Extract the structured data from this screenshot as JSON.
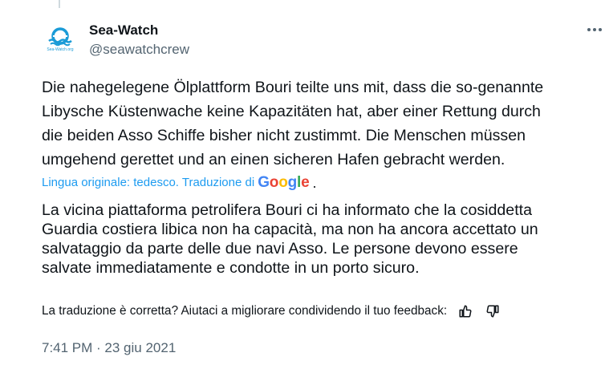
{
  "author": {
    "display_name": "Sea-Watch",
    "handle": "@seawatchcrew",
    "avatar_caption": "Sea-Watch.org"
  },
  "tweet": {
    "original_text": "Die nahegelegene Ölplattform Bouri teilte uns mit, dass die so-genannte\nLibysche Küstenwache keine Kapazitäten hat, aber einer Rettung durch\ndie beiden Asso Schiffe bisher nicht zustimmt. Die Menschen müssen\numgehend gerettet und an einen sicheren Hafen gebracht werden.",
    "translation_note": "Lingua originale: tedesco. Traduzione di",
    "translation_provider": "Google",
    "translated_text": "La vicina piattaforma petrolifera Bouri ci ha informato che la cosiddetta\nGuardia costiera libica non ha capacità, ma non ha ancora accettato un\nsalvataggio da parte delle due navi Asso. Le persone devono essere\nsalvate immediatamente e condotte in un porto sicuro.",
    "feedback_prompt": "La traduzione è corretta? Aiutaci a migliorare condividendo il tuo feedback:",
    "timestamp": "7:41 PM · 23 giu 2021"
  },
  "icons": {
    "more": "more-horizontal-icon",
    "thumbs_up": "thumbs-up-icon",
    "thumbs_down": "thumbs-down-icon"
  },
  "colors": {
    "link_blue": "#1d9bf0",
    "secondary_text": "#536471",
    "primary_text": "#0f1419",
    "brand_blue": "#1a9bd7"
  }
}
